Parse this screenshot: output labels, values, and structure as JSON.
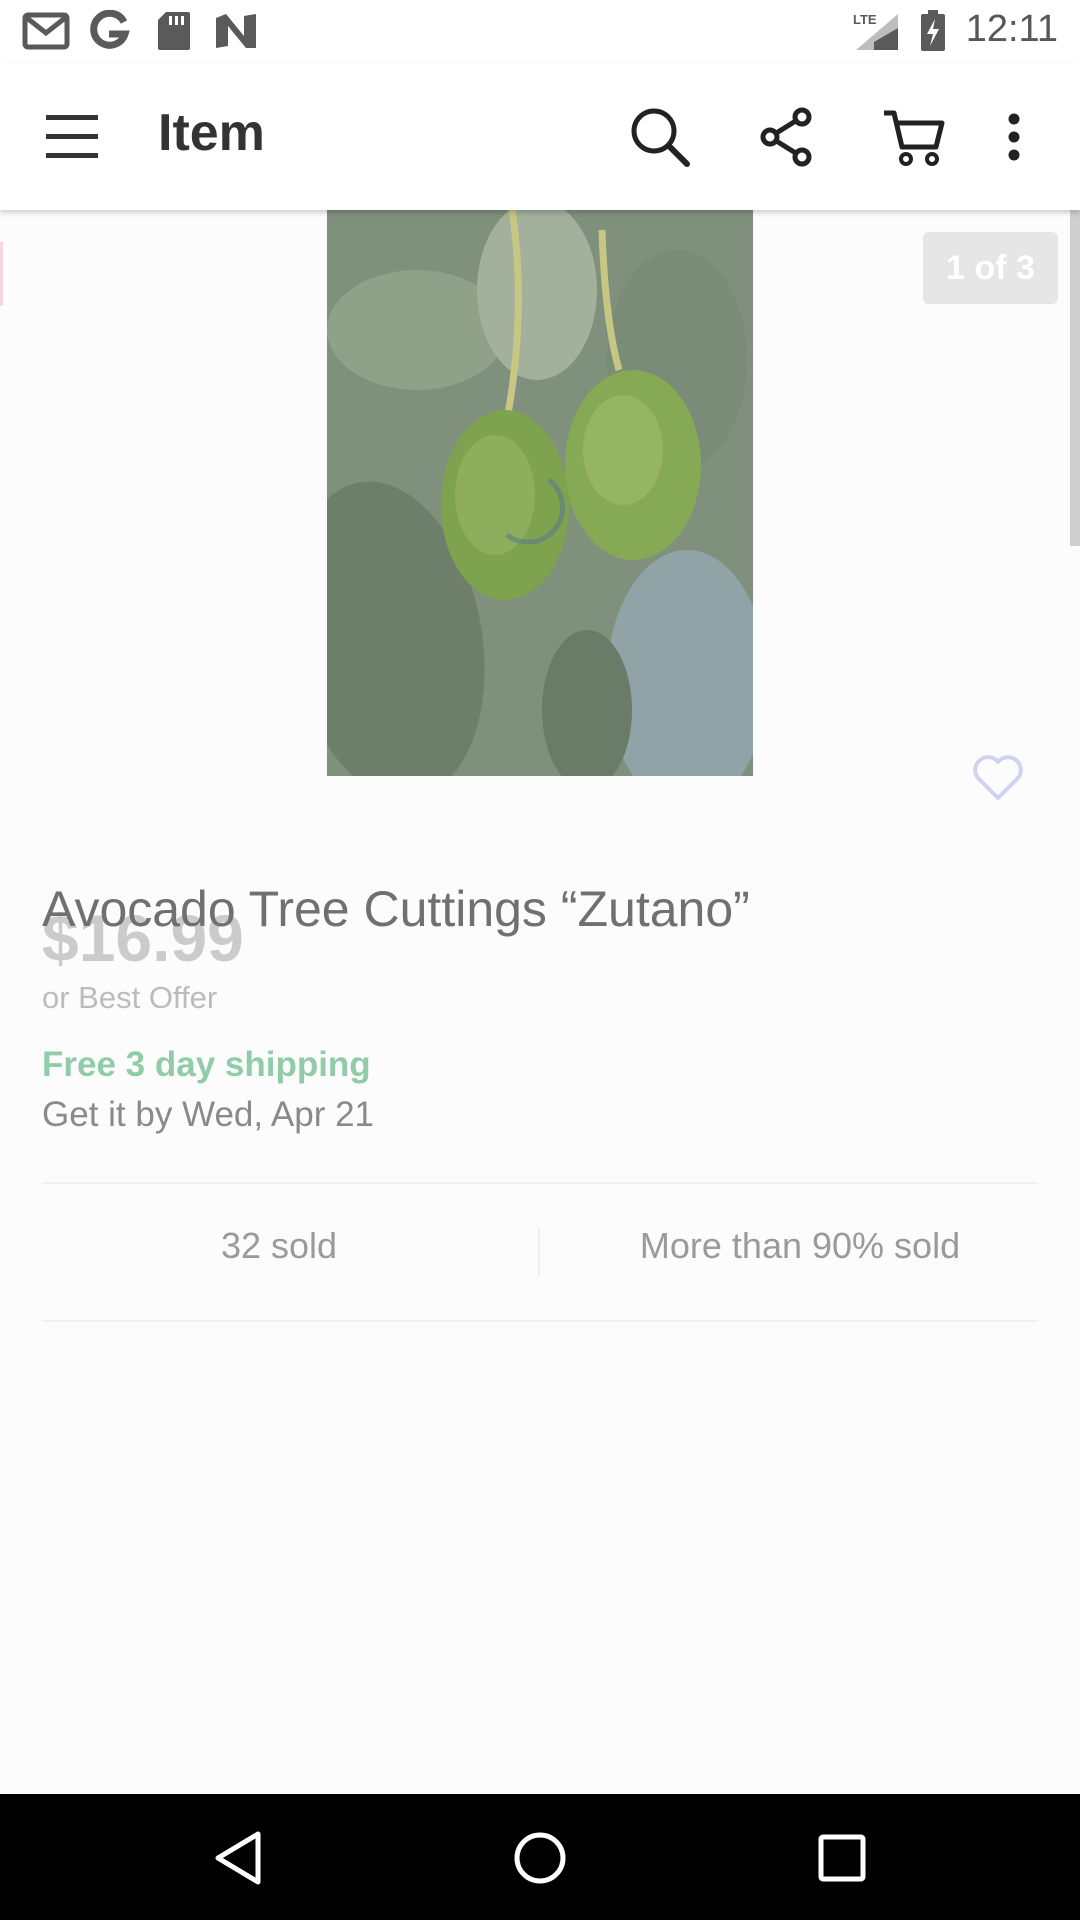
{
  "status_bar": {
    "time": "12:11",
    "network": "LTE",
    "icons": [
      "gmail-icon",
      "google-icon",
      "sd-card-icon",
      "nyt-icon",
      "signal-icon",
      "battery-charging-icon"
    ]
  },
  "app_bar": {
    "title": "Item",
    "icons": [
      "menu-icon",
      "search-icon",
      "share-icon",
      "cart-icon",
      "more-vert-icon"
    ]
  },
  "gallery": {
    "counter": "1 of 3",
    "image_subject": "avocado-photo"
  },
  "item": {
    "title": "Avocado Tree Cuttings “Zutano”",
    "price": "$16.99",
    "best_offer": "or Best Offer",
    "shipping": "Free 3 day shipping",
    "delivery": "Get it by Wed, Apr 21"
  },
  "stats": {
    "sold": "32 sold",
    "percent_sold": "More than 90% sold"
  },
  "colors": {
    "shipping_green": "#8fcca7",
    "nav_bar": "#000000"
  }
}
